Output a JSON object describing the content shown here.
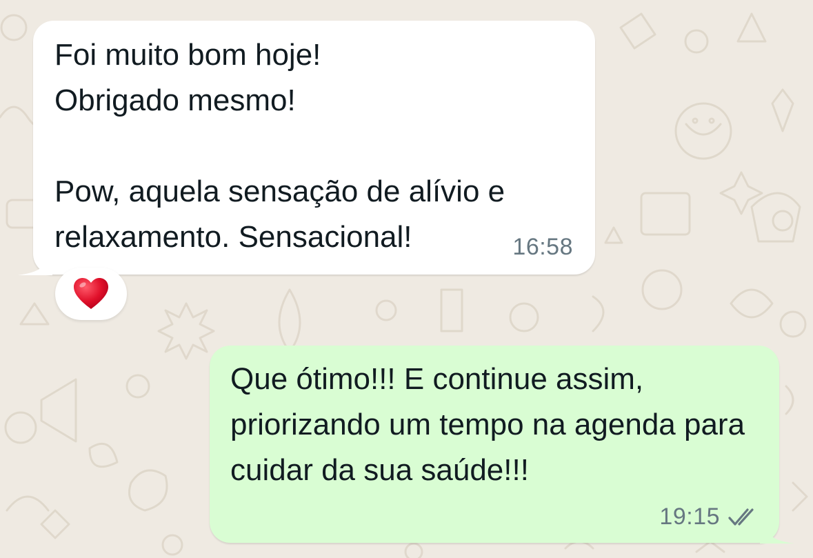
{
  "chat": {
    "messages": [
      {
        "direction": "incoming",
        "text": "Foi muito bom hoje!\nObrigado mesmo!\n\nPow, aquela sensação de alívio e relaxamento. Sensacional!",
        "time": "16:58",
        "reaction": "heart-emoji"
      },
      {
        "direction": "outgoing",
        "text": "Que ótimo!!! E continue assim, priorizando um tempo na agenda para cuidar da sua saúde!!!",
        "time": "19:15",
        "status": "read-double-check-icon"
      }
    ]
  },
  "colors": {
    "background": "#efeae2",
    "incoming_bubble": "#ffffff",
    "outgoing_bubble": "#d9fdd3",
    "text": "#111b21",
    "meta": "#667781",
    "reaction_heart": "#e0102a"
  }
}
